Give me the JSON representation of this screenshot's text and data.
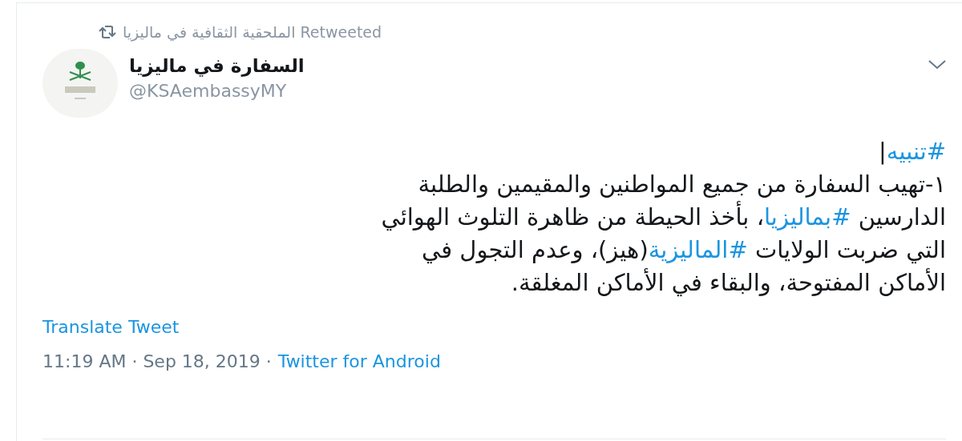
{
  "retweet_bar": {
    "text": "الملحقية الثقافية في ماليزيا Retweeted"
  },
  "author": {
    "name": "السفارة في ماليزيا",
    "handle": "@KSAembassyMY"
  },
  "body": {
    "lines": [
      [
        {
          "kind": "hashtag",
          "text": "#تنبيه"
        },
        {
          "kind": "text",
          "text": "|"
        }
      ],
      [
        {
          "kind": "text",
          "text": "١-تهيب السفارة من جميع المواطنين والمقيمين والطلبة"
        }
      ],
      [
        {
          "kind": "text",
          "text": "الدارسين "
        },
        {
          "kind": "hashtag",
          "text": "#بماليزيا"
        },
        {
          "kind": "text",
          "text": "، بأخذ الحيطة من ظاهرة التلوث الهوائي"
        }
      ],
      [
        {
          "kind": "text",
          "text": "التي ضربت الولايات "
        },
        {
          "kind": "hashtag",
          "text": "#الماليزية"
        },
        {
          "kind": "text",
          "text": "(هيز)، وعدم التجول في"
        }
      ],
      [
        {
          "kind": "text",
          "text": "الأماكن المفتوحة، والبقاء في الأماكن المغلقة."
        }
      ]
    ]
  },
  "translate_link": "Translate Tweet",
  "meta": {
    "timestamp": "11:19 AM · Sep 18, 2019 ·",
    "source": "Twitter for Android"
  }
}
